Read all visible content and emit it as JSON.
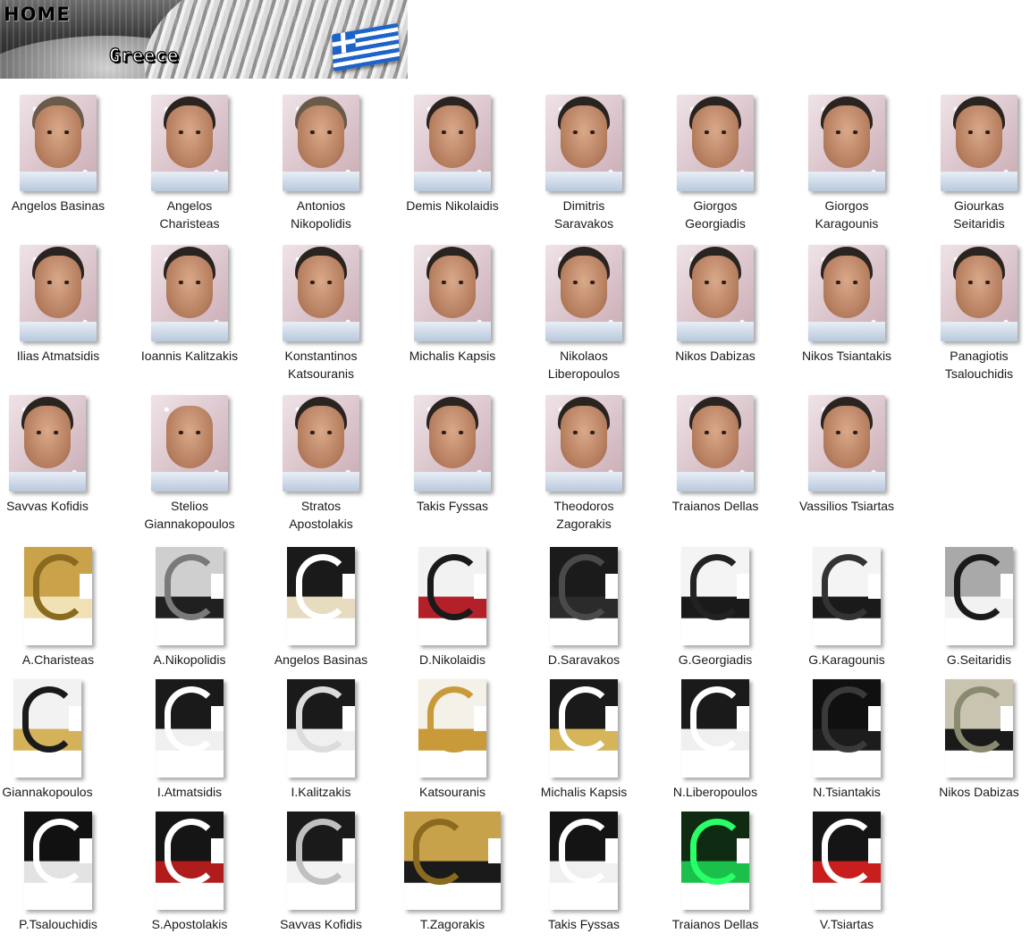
{
  "banner": {
    "home_label": "HOME",
    "country": "Greece",
    "flag": "greece-flag-icon"
  },
  "faces": [
    {
      "name": "Angelos Basinas"
    },
    {
      "name": "Angelos\nCharisteas"
    },
    {
      "name": "Antonios\nNikopolidis"
    },
    {
      "name": "Demis Nikolaidis"
    },
    {
      "name": "Dimitris\nSaravakos"
    },
    {
      "name": "Giorgos\nGeorgiadis"
    },
    {
      "name": "Giorgos\nKaragounis"
    },
    {
      "name": "Giourkas\nSeitaridis"
    },
    {
      "name": "Ilias Atmatsidis"
    },
    {
      "name": "Ioannis Kalitzakis"
    },
    {
      "name": "Konstantinos\nKatsouranis"
    },
    {
      "name": "Michalis Kapsis"
    },
    {
      "name": "Nikolaos\nLiberopoulos"
    },
    {
      "name": "Nikos Dabizas"
    },
    {
      "name": "Nikos Tsiantakis"
    },
    {
      "name": "Panagiotis\nTsalouchidis"
    },
    {
      "name": "Savvas Kofidis"
    },
    {
      "name": "Stelios\nGiannakopoulos"
    },
    {
      "name": "Stratos\nApostolakis"
    },
    {
      "name": "Takis Fyssas"
    },
    {
      "name": "Theodoros\nZagorakis"
    },
    {
      "name": "Traianos Dellas"
    },
    {
      "name": "Vassilios Tsiartas"
    }
  ],
  "boots": [
    {
      "name": "A.Charisteas",
      "c1": "#c9a24a",
      "c2": "#f0e2b5",
      "c3": "#8a6a1e"
    },
    {
      "name": "A.Nikopolidis",
      "c1": "#cfcfcf",
      "c2": "#202020",
      "c3": "#7a7a7a"
    },
    {
      "name": "Angelos Basinas",
      "c1": "#1a1a1a",
      "c2": "#e7dcc0",
      "c3": "#ffffff"
    },
    {
      "name": "D.Nikolaidis",
      "c1": "#f2f2f2",
      "c2": "#b3202a",
      "c3": "#1a1a1a"
    },
    {
      "name": "D.Saravakos",
      "c1": "#1b1b1b",
      "c2": "#2b2b2b",
      "c3": "#4a4a4a"
    },
    {
      "name": "G.Georgiadis",
      "c1": "#f4f4f4",
      "c2": "#1a1a1a",
      "c3": "#222222"
    },
    {
      "name": "G.Karagounis",
      "c1": "#f4f4f4",
      "c2": "#1a1a1a",
      "c3": "#333333"
    },
    {
      "name": "G.Seitaridis",
      "c1": "#a9a9a9",
      "c2": "#f2f2f2",
      "c3": "#1a1a1a"
    },
    {
      "name": "Giannakopoulos",
      "c1": "#f2f2f2",
      "c2": "#d4b25a",
      "c3": "#1a1a1a"
    },
    {
      "name": "I.Atmatsidis",
      "c1": "#1a1a1a",
      "c2": "#f0f0f0",
      "c3": "#ffffff"
    },
    {
      "name": "I.Kalitzakis",
      "c1": "#1a1a1a",
      "c2": "#f0f0f0",
      "c3": "#dcdcdc"
    },
    {
      "name": "Katsouranis",
      "c1": "#f4f1e8",
      "c2": "#c89a3a",
      "c3": "#c89a3a"
    },
    {
      "name": "Michalis Kapsis",
      "c1": "#1a1a1a",
      "c2": "#d6b45a",
      "c3": "#ffffff"
    },
    {
      "name": "N.Liberopoulos",
      "c1": "#1a1a1a",
      "c2": "#f0f0f0",
      "c3": "#ffffff"
    },
    {
      "name": "N.Tsiantakis",
      "c1": "#101010",
      "c2": "#1c1c1c",
      "c3": "#3a3a3a"
    },
    {
      "name": "Nikos Dabizas",
      "c1": "#c9c4b0",
      "c2": "#1a1a1a",
      "c3": "#8a8a70"
    },
    {
      "name": "P.Tsalouchidis",
      "c1": "#111111",
      "c2": "#e3e3e3",
      "c3": "#ffffff"
    },
    {
      "name": "S.Apostolakis",
      "c1": "#151515",
      "c2": "#b01c1c",
      "c3": "#ffffff"
    },
    {
      "name": "Savvas Kofidis",
      "c1": "#1a1a1a",
      "c2": "#f2f2f2",
      "c3": "#c0c0c0"
    },
    {
      "name": "T.Zagorakis",
      "c1": "#c8a24a",
      "c2": "#1a1a1a",
      "c3": "#8a6a1e"
    },
    {
      "name": "Takis Fyssas",
      "c1": "#141414",
      "c2": "#f0f0f0",
      "c3": "#ffffff"
    },
    {
      "name": "Traianos Dellas",
      "c1": "#0f2b12",
      "c2": "#1ac04a",
      "c3": "#2aff6a"
    },
    {
      "name": "V.Tsiartas",
      "c1": "#151515",
      "c2": "#c81e1e",
      "c3": "#ffffff"
    }
  ]
}
